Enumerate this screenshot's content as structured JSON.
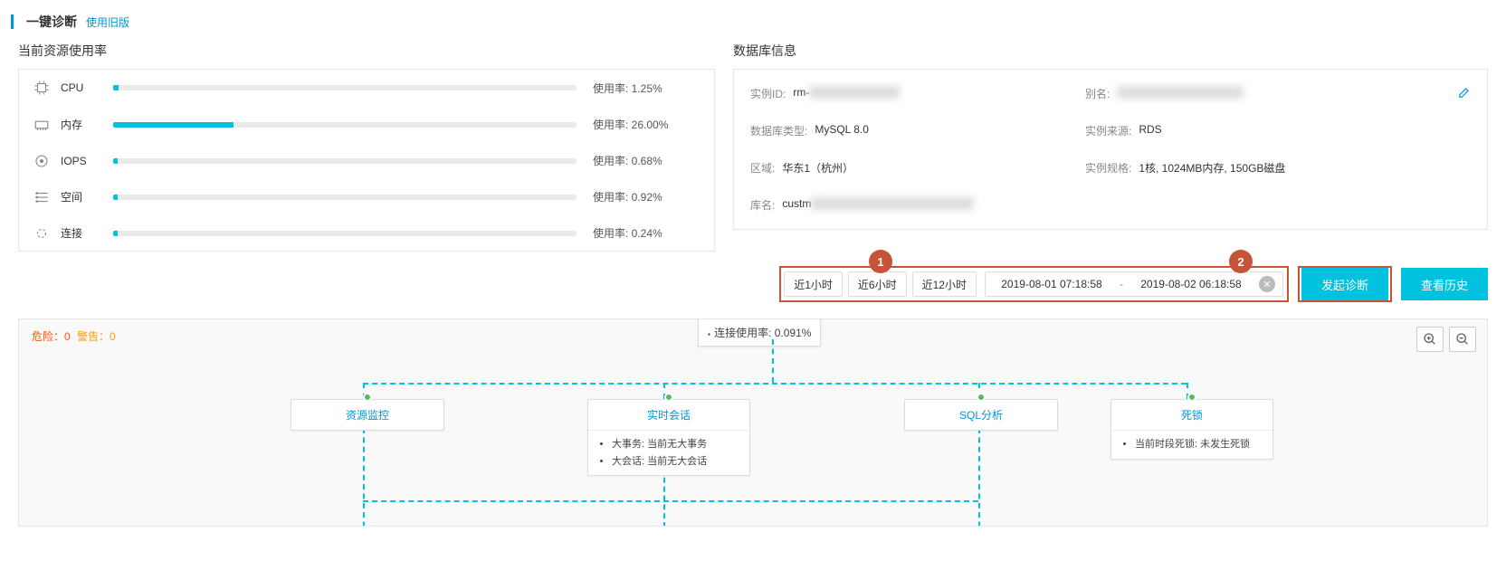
{
  "header": {
    "title": "一键诊断",
    "old_link": "使用旧版"
  },
  "usage_panel": {
    "title": "当前资源使用率",
    "metrics": [
      {
        "name": "CPU",
        "label": "使用率: 1.25%",
        "pct": 1.25
      },
      {
        "name": "内存",
        "label": "使用率: 26.00%",
        "pct": 26.0
      },
      {
        "name": "IOPS",
        "label": "使用率: 0.68%",
        "pct": 0.68
      },
      {
        "name": "空间",
        "label": "使用率: 0.92%",
        "pct": 0.92
      },
      {
        "name": "连接",
        "label": "使用率: 0.24%",
        "pct": 0.24
      }
    ]
  },
  "info_panel": {
    "title": "数据库信息",
    "fields": {
      "instance_id_label": "实例ID:",
      "instance_id_value": "rm-",
      "alias_label": "别名:",
      "db_type_label": "数据库类型:",
      "db_type_value": "MySQL 8.0",
      "source_label": "实例来源:",
      "source_value": "RDS",
      "region_label": "区域:",
      "region_value": "华东1（杭州）",
      "spec_label": "实例规格:",
      "spec_value": "1核, 1024MB内存, 150GB磁盘",
      "dbname_label": "库名:",
      "dbname_value": "custm"
    }
  },
  "controls": {
    "presets": [
      "近1小时",
      "近6小时",
      "近12小时"
    ],
    "start_time": "2019-08-01 07:18:58",
    "end_time": "2019-08-02 06:18:58",
    "sep": "-",
    "diagnose_btn": "发起诊断",
    "history_btn": "查看历史"
  },
  "annotations": {
    "n1": "1",
    "n2": "2"
  },
  "diagram": {
    "risk_label": "危险：0",
    "warn_label": "警告：0",
    "tooltip": "连接使用率: 0.091%",
    "nodes": {
      "resource": {
        "title": "资源监控"
      },
      "session": {
        "title": "实时会话",
        "lines": [
          "大事务: 当前无大事务",
          "大会话: 当前无大会话"
        ]
      },
      "sql": {
        "title": "SQL分析"
      },
      "deadlock": {
        "title": "死锁",
        "lines": [
          "当前时段死锁: 未发生死锁"
        ]
      }
    }
  }
}
